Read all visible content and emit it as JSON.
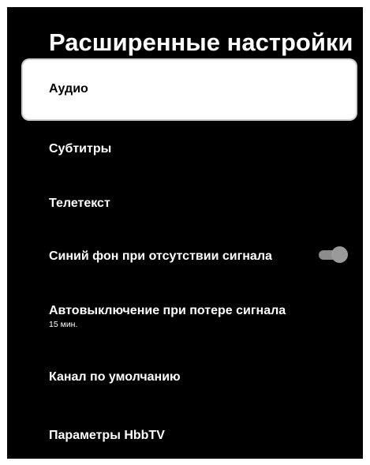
{
  "header": {
    "title": "Расширенные настройки"
  },
  "menu": {
    "items": [
      {
        "label": "Аудио",
        "selected": true
      },
      {
        "label": "Субтитры"
      },
      {
        "label": "Телетекст"
      },
      {
        "label": "Синий фон при отсутствии сигнала",
        "toggle": {
          "state": "on",
          "color": "#8c8c8c"
        }
      },
      {
        "label": "Автовыключение при потере сигнала",
        "value": "15 мин."
      },
      {
        "label": "Канал по умолчанию"
      },
      {
        "label": "Параметры HbbTV"
      }
    ]
  },
  "colors": {
    "background": "#000000",
    "text": "#ffffff",
    "selected_background": "#ffffff",
    "selected_text": "#000000"
  }
}
